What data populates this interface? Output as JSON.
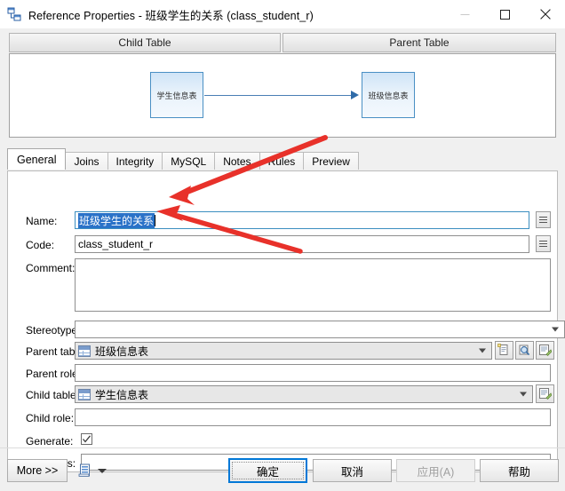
{
  "window": {
    "title": "Reference Properties - 班级学生的关系 (class_student_r)",
    "icon": "reference-icon",
    "minimize_label": "–",
    "maximize_label": "□",
    "close_label": "✕"
  },
  "preview": {
    "child_header": "Child Table",
    "parent_header": "Parent Table",
    "child_box": "学生信息表",
    "parent_box": "班级信息表"
  },
  "tabs": [
    {
      "label": "General",
      "active": true
    },
    {
      "label": "Joins",
      "active": false
    },
    {
      "label": "Integrity",
      "active": false
    },
    {
      "label": "MySQL",
      "active": false
    },
    {
      "label": "Notes",
      "active": false
    },
    {
      "label": "Rules",
      "active": false
    },
    {
      "label": "Preview",
      "active": false
    }
  ],
  "form": {
    "name": {
      "label": "Name:",
      "value": "班级学生的关系",
      "selected": true
    },
    "code": {
      "label": "Code:",
      "value": "class_student_r"
    },
    "comment": {
      "label": "Comment:",
      "value": ""
    },
    "stereotype": {
      "label": "Stereotype:",
      "value": ""
    },
    "parent_table": {
      "label": "Parent table:",
      "value": "班级信息表",
      "icon": "table-icon"
    },
    "parent_role": {
      "label": "Parent role:",
      "value": ""
    },
    "child_table": {
      "label": "Child table:",
      "value": "学生信息表",
      "icon": "table-icon"
    },
    "child_role": {
      "label": "Child role:",
      "value": ""
    },
    "generate": {
      "label": "Generate:",
      "checked": true
    },
    "keywords": {
      "label": "Keywords:",
      "value": ""
    }
  },
  "side_buttons": {
    "name_equals": "=",
    "code_equals": "=",
    "parent_create": "create-object-icon",
    "parent_browse": "browse-magnifier-icon",
    "parent_properties": "properties-icon",
    "child_properties": "properties-icon"
  },
  "footer": {
    "more": "More >>",
    "report_icon": "report-icon",
    "ok": "确定",
    "cancel": "取消",
    "apply": "应用(A)",
    "help": "帮助"
  },
  "annotations": {
    "arrow_color": "#e8312a",
    "arrow1_target": "name-field",
    "arrow2_target": "code-field"
  }
}
